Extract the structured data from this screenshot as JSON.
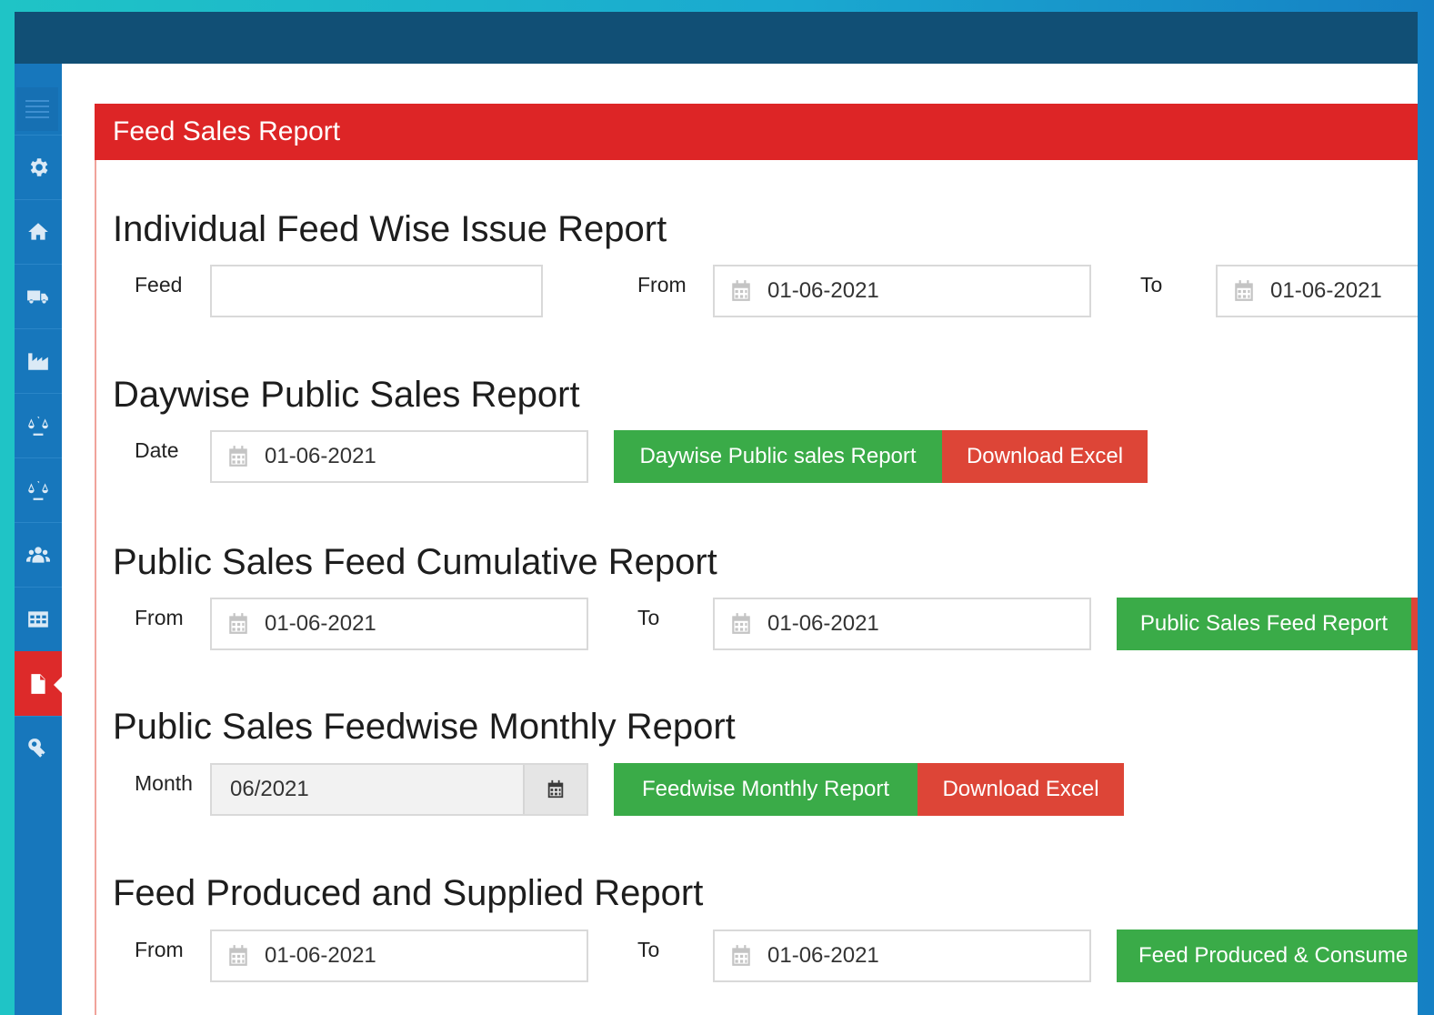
{
  "panel": {
    "title": "Feed Sales Report"
  },
  "sections": [
    {
      "title": "Individual Feed Wise Issue Report",
      "feed_label": "Feed",
      "feed_value": "",
      "from_label": "From",
      "from_value": "01-06-2021",
      "to_label": "To",
      "to_value": "01-06-2021"
    },
    {
      "title": "Daywise Public Sales Report",
      "date_label": "Date",
      "date_value": "01-06-2021",
      "report_button": "Daywise Public sales Report",
      "excel_button": "Download Excel"
    },
    {
      "title": "Public Sales Feed Cumulative Report",
      "from_label": "From",
      "from_value": "01-06-2021",
      "to_label": "To",
      "to_value": "01-06-2021",
      "report_button": "Public Sales Feed Report"
    },
    {
      "title": "Public Sales Feedwise Monthly Report",
      "month_label": "Month",
      "month_value": "06/2021",
      "report_button": "Feedwise Monthly Report",
      "excel_button": "Download Excel"
    },
    {
      "title": "Feed Produced and Supplied Report",
      "from_label": "From",
      "from_value": "01-06-2021",
      "to_label": "To",
      "to_value": "01-06-2021",
      "report_button": "Feed Produced & Consume"
    }
  ],
  "sidebar": {
    "items": [
      {
        "icon": "gear-icon"
      },
      {
        "icon": "home-icon"
      },
      {
        "icon": "truck-icon"
      },
      {
        "icon": "factory-icon"
      },
      {
        "icon": "balance-scale-icon"
      },
      {
        "icon": "balance-scale-icon"
      },
      {
        "icon": "users-icon"
      },
      {
        "icon": "table-icon"
      },
      {
        "icon": "file-icon",
        "active": true
      },
      {
        "icon": "key-icon"
      }
    ]
  },
  "colors": {
    "topbar": "#114f75",
    "sidebar": "#1777bc",
    "header": "#dd2526",
    "green_button": "#3aab48",
    "red_button": "#dd4537"
  }
}
